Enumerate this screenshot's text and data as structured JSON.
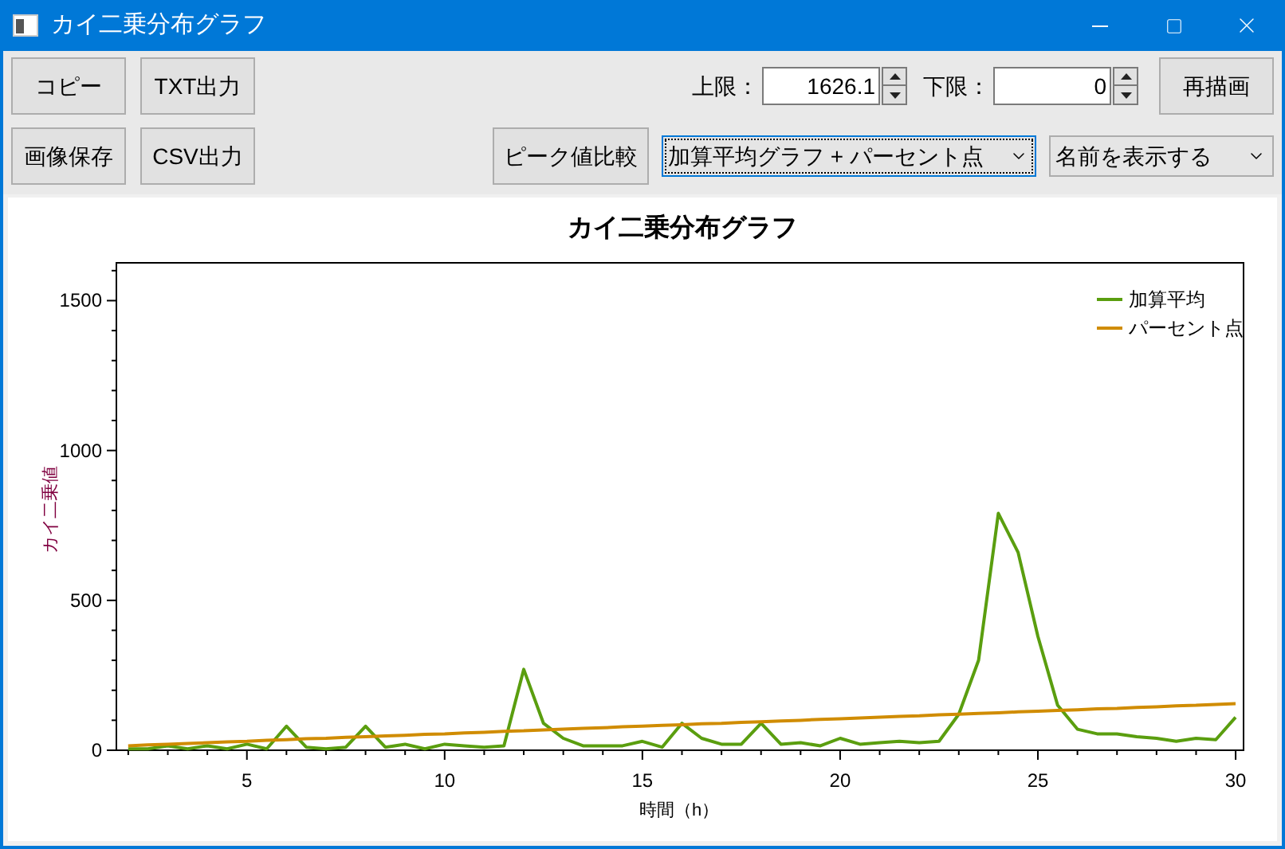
{
  "window": {
    "title": "カイ二乗分布グラフ"
  },
  "toolbar": {
    "row_1_buttons": [
      "コピー",
      "TXT出力"
    ],
    "row_2_buttons": [
      "画像保存",
      "CSV出力"
    ],
    "upper_limit": {
      "label": "上限：",
      "value": "1626.1"
    },
    "lower_limit": {
      "label": "下限：",
      "value": "0"
    },
    "redraw_button": "再描画",
    "peak_button": "ピーク値比較",
    "graph_mode": {
      "value": "加算平均グラフ + パーセント点",
      "focused": true
    },
    "name_display": {
      "value": "名前を表示する",
      "focused": false
    }
  },
  "chart": {
    "chart_data": {
      "type": "line",
      "title": "カイ二乗分布グラフ",
      "xlabel": "時間（h）",
      "ylabel": "カイ二乗値",
      "x": [
        2,
        2.5,
        3,
        3.5,
        4,
        4.5,
        5,
        5.5,
        6,
        6.5,
        7,
        7.5,
        8,
        8.5,
        9,
        9.5,
        10,
        10.5,
        11,
        11.5,
        12,
        12.5,
        13,
        13.5,
        14,
        14.5,
        15,
        15.5,
        16,
        16.5,
        17,
        17.5,
        18,
        18.5,
        19,
        19.5,
        20,
        20.5,
        21,
        21.5,
        22,
        22.5,
        23,
        23.5,
        24,
        24.5,
        25,
        25.5,
        26,
        26.5,
        27,
        27.5,
        28,
        28.5,
        29,
        29.5,
        30
      ],
      "series": [
        {
          "name": "加算平均",
          "color": "#5a9e0f",
          "values": [
            5,
            5,
            15,
            5,
            15,
            5,
            20,
            5,
            80,
            10,
            5,
            10,
            80,
            10,
            20,
            5,
            20,
            15,
            10,
            15,
            270,
            90,
            40,
            15,
            15,
            15,
            30,
            10,
            90,
            40,
            20,
            20,
            90,
            20,
            25,
            15,
            40,
            20,
            25,
            30,
            25,
            30,
            120,
            300,
            790,
            660,
            380,
            150,
            70,
            55,
            55,
            45,
            40,
            30,
            40,
            35,
            110
          ]
        },
        {
          "name": "パーセント点",
          "color": "#d08c00",
          "values": [
            15,
            18,
            20,
            23,
            25,
            28,
            30,
            33,
            35,
            38,
            40,
            43,
            45,
            48,
            50,
            53,
            55,
            58,
            60,
            63,
            65,
            68,
            70,
            73,
            75,
            78,
            80,
            83,
            85,
            88,
            90,
            93,
            95,
            98,
            100,
            103,
            105,
            108,
            110,
            113,
            115,
            118,
            120,
            123,
            125,
            128,
            130,
            133,
            135,
            138,
            140,
            143,
            145,
            148,
            150,
            153,
            155
          ]
        }
      ],
      "legend": true,
      "xlim": [
        1.7,
        30.2
      ],
      "ylim": [
        0,
        1626.1
      ],
      "xticks": [
        5,
        10,
        15,
        20,
        25,
        30
      ],
      "yticks": [
        0,
        500,
        1000,
        1500
      ]
    }
  }
}
